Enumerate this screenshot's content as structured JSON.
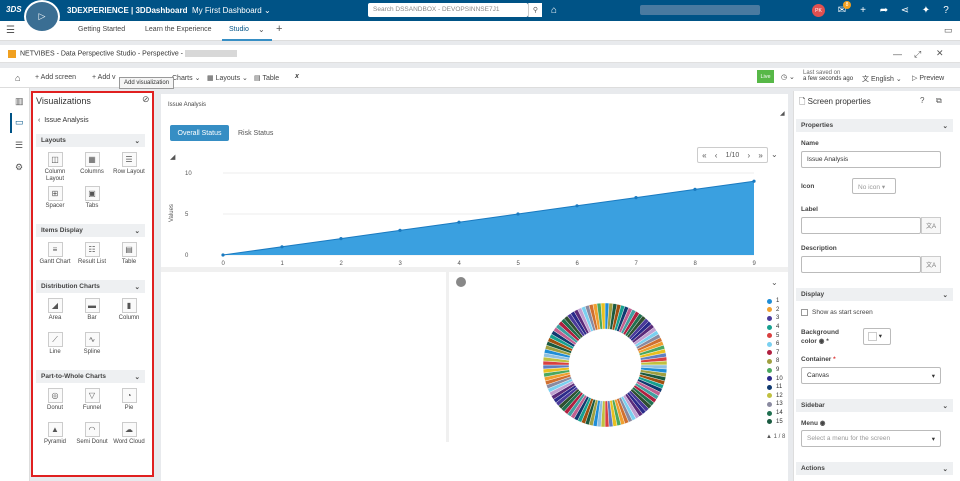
{
  "topbar": {
    "logo": "3DS",
    "brand": "3DEXPERIENCE | 3DDashboard",
    "dashboard": "My First Dashboard",
    "search_placeholder": "Search DSSANDBOX - DEVOPSINNSE7J1",
    "avatar": "PK",
    "badge": "8"
  },
  "tabs": [
    "Getting Started",
    "Learn the Experience",
    "Studio"
  ],
  "app": {
    "title": "NETVIBES - Data Perspective Studio - Perspective -"
  },
  "toolbar": {
    "add_screen": "+ Add screen",
    "add_v": "+ Add v",
    "charts": "Charts",
    "layouts": "Layouts",
    "table": "Table",
    "live": "Live",
    "last_saved": "Last saved on",
    "ago": "a few seconds ago",
    "language": "English",
    "preview": "Preview"
  },
  "tooltip": "Add visualization",
  "vis": {
    "title": "Visualizations",
    "back": "Issue Analysis",
    "sections": [
      {
        "name": "Layouts",
        "items": [
          {
            "label": "Column Layout",
            "icon": "column-layout-icon",
            "g": "◫"
          },
          {
            "label": "Columns",
            "icon": "columns-icon",
            "g": "▦"
          },
          {
            "label": "Row Layout",
            "icon": "row-layout-icon",
            "g": "☰"
          },
          {
            "label": "Spacer",
            "icon": "spacer-icon",
            "g": "⊞"
          },
          {
            "label": "Tabs",
            "icon": "tabs-icon",
            "g": "▣"
          }
        ]
      },
      {
        "name": "Items Display",
        "items": [
          {
            "label": "Gantt Chart",
            "icon": "gantt-chart-icon",
            "g": "≡"
          },
          {
            "label": "Result List",
            "icon": "result-list-icon",
            "g": "☷"
          },
          {
            "label": "Table",
            "icon": "table-icon",
            "g": "▤"
          }
        ]
      },
      {
        "name": "Distribution Charts",
        "items": [
          {
            "label": "Area",
            "icon": "area-chart-icon",
            "g": "◢"
          },
          {
            "label": "Bar",
            "icon": "bar-chart-icon",
            "g": "▬"
          },
          {
            "label": "Column",
            "icon": "column-chart-icon",
            "g": "▮"
          },
          {
            "label": "Line",
            "icon": "line-chart-icon",
            "g": "⟋"
          },
          {
            "label": "Spline",
            "icon": "spline-chart-icon",
            "g": "∿"
          }
        ]
      },
      {
        "name": "Part-to-Whole Charts",
        "items": [
          {
            "label": "Donut",
            "icon": "donut-chart-icon",
            "g": "◎"
          },
          {
            "label": "Funnel",
            "icon": "funnel-chart-icon",
            "g": "▽"
          },
          {
            "label": "Pie",
            "icon": "pie-chart-icon",
            "g": "◔"
          },
          {
            "label": "Pyramid",
            "icon": "pyramid-chart-icon",
            "g": "▲"
          },
          {
            "label": "Semi Donut",
            "icon": "semi-donut-icon",
            "g": "◠"
          },
          {
            "label": "Word Cloud",
            "icon": "word-cloud-icon",
            "g": "☁"
          }
        ]
      }
    ]
  },
  "canvas": {
    "label": "Issue Analysis",
    "tab_overall": "Overall Status",
    "tab_risk": "Risk Status",
    "pager": "1/10"
  },
  "chart_data": [
    {
      "type": "area",
      "x": [
        0,
        1,
        2,
        3,
        4,
        5,
        6,
        7,
        8,
        9
      ],
      "values": [
        0,
        1,
        2,
        3,
        4,
        5,
        6,
        7,
        8,
        9
      ],
      "ylabel": "Values",
      "ylim": [
        0,
        10
      ],
      "yticks": [
        0,
        5,
        10
      ],
      "color": "#3aa0e0"
    },
    {
      "type": "pie",
      "note_shape": "donut",
      "legend": [
        "1",
        "2",
        "3",
        "4",
        "5",
        "6",
        "7",
        "8",
        "9",
        "10",
        "11",
        "12",
        "13",
        "14",
        "15"
      ],
      "legend_colors": [
        "#1f8dd6",
        "#f0a030",
        "#4a3a9a",
        "#18a090",
        "#d94040",
        "#7ad0f0",
        "#b02040",
        "#a0a040",
        "#4aa860",
        "#2a2a8a",
        "#103a70",
        "#c0c040",
        "#8a8aa0",
        "#207050",
        "#1a5a40"
      ],
      "legend_page": "1 / 8"
    }
  ],
  "props": {
    "title": "Screen properties",
    "properties": "Properties",
    "name_label": "Name",
    "name_value": "Issue Analysis",
    "icon_label": "Icon",
    "icon_value": "No icon",
    "label_label": "Label",
    "desc_label": "Description",
    "display": "Display",
    "show_start": "Show as start screen",
    "bg_label": "Background color",
    "container_label": "Container",
    "container_value": "Canvas",
    "sidebar": "Sidebar",
    "menu_label": "Menu",
    "menu_placeholder": "Select a menu for the screen",
    "actions": "Actions"
  }
}
